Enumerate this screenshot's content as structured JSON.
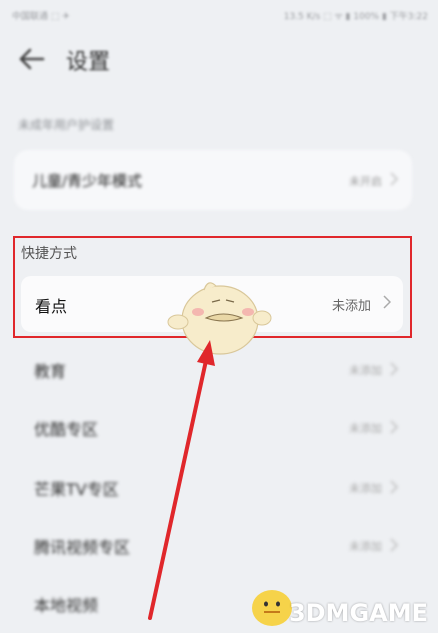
{
  "status_bar": {
    "carrier": "中国联通 ⬚ ✈",
    "right": "13.5 K/s ⬚ ᯤ ▮ 100% ▮ 下午3:22"
  },
  "header": {
    "title": "设置",
    "back_icon": "back-arrow-icon"
  },
  "minor_protection": {
    "section_label": "未成年用户护设置",
    "row_label": "儿童/青少年模式",
    "row_value": "未开启"
  },
  "shortcuts": {
    "section_label": "快捷方式",
    "highlighted": {
      "label": "看点",
      "value": "未添加"
    },
    "items": [
      {
        "label": "教育",
        "value": "未添加"
      },
      {
        "label": "优酷专区",
        "value": "未添加"
      },
      {
        "label": "芒果TV专区",
        "value": "未添加"
      },
      {
        "label": "腾讯视频专区",
        "value": "未添加"
      },
      {
        "label": "本地视频",
        "value": ""
      }
    ]
  },
  "watermark": {
    "text": "3DMGAME"
  },
  "colors": {
    "highlight": "#e0272b",
    "background": "#eef0f3"
  }
}
